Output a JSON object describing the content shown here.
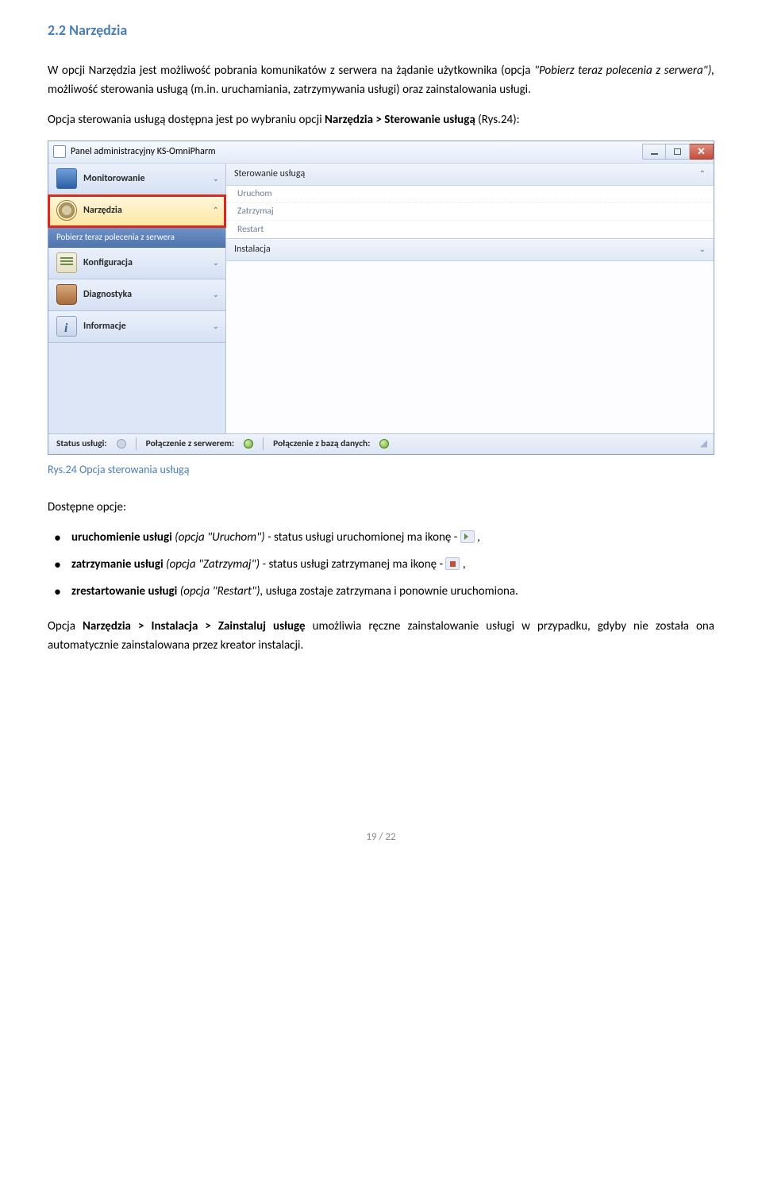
{
  "section": {
    "title": "2.2 Narzędzia"
  },
  "para1": {
    "p1a": "W opcji Narzędzia jest możliwość pobrania komunikatów z serwera na żądanie użytkownika (opcja ",
    "p1b": "\"Pobierz teraz polecenia z serwera\"), ",
    "p1c": "możliwość sterowania usługą (m.in. uruchamiania, zatrzymywania usługi) oraz zainstalowania usługi."
  },
  "para2": {
    "a": "Opcja sterowania usługą dostępna jest po wybraniu opcji ",
    "b": "Narzędzia > Sterowanie usługą",
    "c": "  (Rys.24):"
  },
  "window": {
    "title": "Panel administracyjny KS-OmniPharm",
    "sidebar": {
      "monitor": "Monitorowanie",
      "tools": "Narzędzia",
      "tools_sub": "Pobierz teraz polecenia z serwera",
      "config": "Konfiguracja",
      "diag": "Diagnostyka",
      "info": "Informacje"
    },
    "content": {
      "head1": "Sterowanie usługą",
      "items": {
        "a": "Uruchom",
        "b": "Zatrzymaj",
        "c": "Restart"
      },
      "head2": "Instalacja"
    },
    "status": {
      "a": "Status usługi:",
      "b": "Połączenie z serwerem:",
      "c": "Połączenie z bazą danych:"
    }
  },
  "caption": "Rys.24 Opcja sterowania usługą",
  "afterCaption": "Dostępne opcje:",
  "bullets": {
    "b1a": "uruchomienie usługi ",
    "b1b": "(opcja \"Uruchom\") - ",
    "b1c": "status usługi uruchomionej ma ikonę - ",
    "b1d": " ,",
    "b2a": "zatrzymanie usługi ",
    "b2b": "(opcja \"Zatrzymaj\") - ",
    "b2c": "status usługi zatrzymanej ma ikonę - ",
    "b2d": " ,",
    "b3a": "zrestartowanie usługi ",
    "b3b": "(opcja \"Restart\"), ",
    "b3c": "usługa zostaje zatrzymana i ponownie uruchomiona."
  },
  "para3": {
    "a": "Opcja ",
    "b": "Narzędzia > Instalacja > Zainstaluj usługę ",
    "c": "umożliwia ręczne zainstalowanie usługi w przypadku, gdyby nie została ona automatycznie zainstalowana przez kreator instalacji."
  },
  "footer": "19 / 22"
}
